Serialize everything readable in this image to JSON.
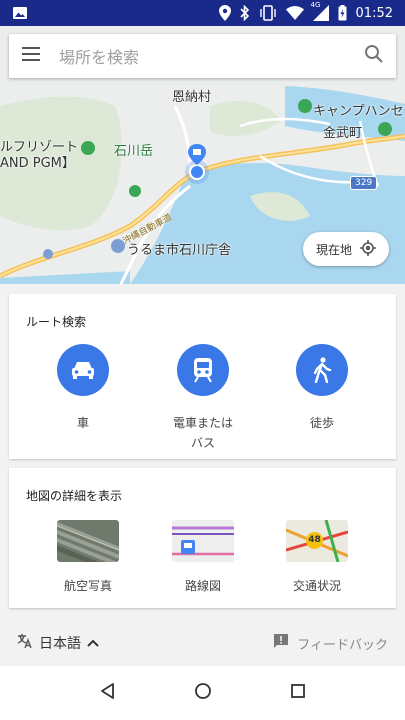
{
  "status_bar": {
    "time": "01:52",
    "network_label": "4G"
  },
  "search": {
    "placeholder": "場所を検索"
  },
  "map": {
    "labels": {
      "onna": "恩納村",
      "camp_hansen": "キャンプハンセン",
      "kin": "金武町",
      "resort": "ルフリゾート",
      "resort2": "AND PGM】",
      "ishikawadake": "石川岳",
      "expressway": "沖縄自動車道",
      "uruma": "うるま市石川庁舎",
      "route329": "329"
    },
    "current_location_button": "現在地"
  },
  "route_card": {
    "title": "ルート検索",
    "modes": [
      {
        "label": "車",
        "icon": "car-icon"
      },
      {
        "label": "電車または\nバス",
        "label_line1": "電車または",
        "label_line2": "バス",
        "icon": "train-icon"
      },
      {
        "label": "徒歩",
        "icon": "walk-icon"
      }
    ]
  },
  "detail_card": {
    "title": "地図の詳細を表示",
    "layers": [
      {
        "label": "航空写真"
      },
      {
        "label": "路線図"
      },
      {
        "label": "交通状況",
        "badge": "48"
      }
    ]
  },
  "footer": {
    "language": "日本語",
    "feedback": "フィードバック"
  },
  "colors": {
    "status_bar": "#1a2a8a",
    "accent": "#3b78e7"
  }
}
